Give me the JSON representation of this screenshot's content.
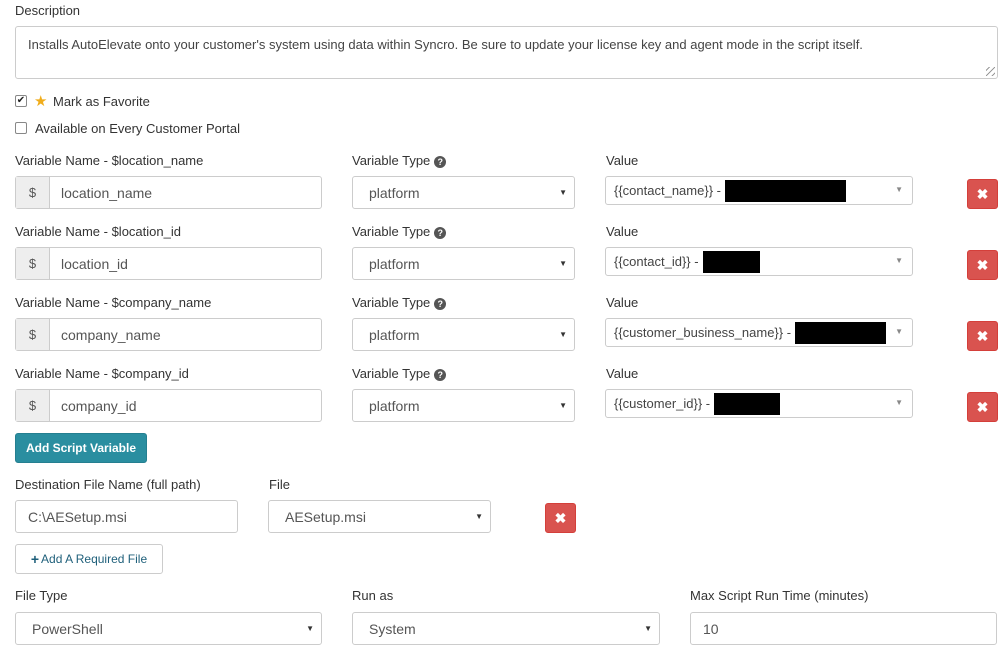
{
  "description": {
    "label": "Description",
    "value": "Installs AutoElevate onto your customer's system using data within Syncro.  Be sure to update your license key and agent mode in the script itself."
  },
  "favorite": {
    "label": "Mark as Favorite",
    "checked": true
  },
  "portal": {
    "label": "Available on Every Customer Portal",
    "checked": false
  },
  "variables": [
    {
      "name_label": "Variable Name - $location_name",
      "name_value": "location_name",
      "type_label": "Variable Type",
      "type_value": "platform",
      "value_label": "Value",
      "value_text": "{{contact_name}} -"
    },
    {
      "name_label": "Variable Name - $location_id",
      "name_value": "location_id",
      "type_label": "Variable Type",
      "type_value": "platform",
      "value_label": "Value",
      "value_text": "{{contact_id}} -"
    },
    {
      "name_label": "Variable Name - $company_name",
      "name_value": "company_name",
      "type_label": "Variable Type",
      "type_value": "platform",
      "value_label": "Value",
      "value_text": "{{customer_business_name}} -"
    },
    {
      "name_label": "Variable Name - $company_id",
      "name_value": "company_id",
      "type_label": "Variable Type",
      "type_value": "platform",
      "value_label": "Value",
      "value_text": "{{customer_id}} -"
    }
  ],
  "dollar": "$",
  "add_variable_label": "Add Script Variable",
  "file": {
    "dest_label": "Destination File Name (full path)",
    "dest_value": "C:\\AESetup.msi",
    "file_label": "File",
    "file_value": "AESetup.msi"
  },
  "add_file_label": "Add A Required File",
  "file_type": {
    "label": "File Type",
    "value": "PowerShell"
  },
  "run_as": {
    "label": "Run as",
    "value": "System"
  },
  "max_runtime": {
    "label": "Max Script Run Time (minutes)",
    "value": "10"
  },
  "icons": {
    "delete": "✖",
    "caret": "▼",
    "plus": "+",
    "check": "✔",
    "star": "★",
    "help": "?"
  },
  "colors": {
    "danger": "#d9534f",
    "primary": "#2a8ea0",
    "star": "#f0ad1c"
  }
}
